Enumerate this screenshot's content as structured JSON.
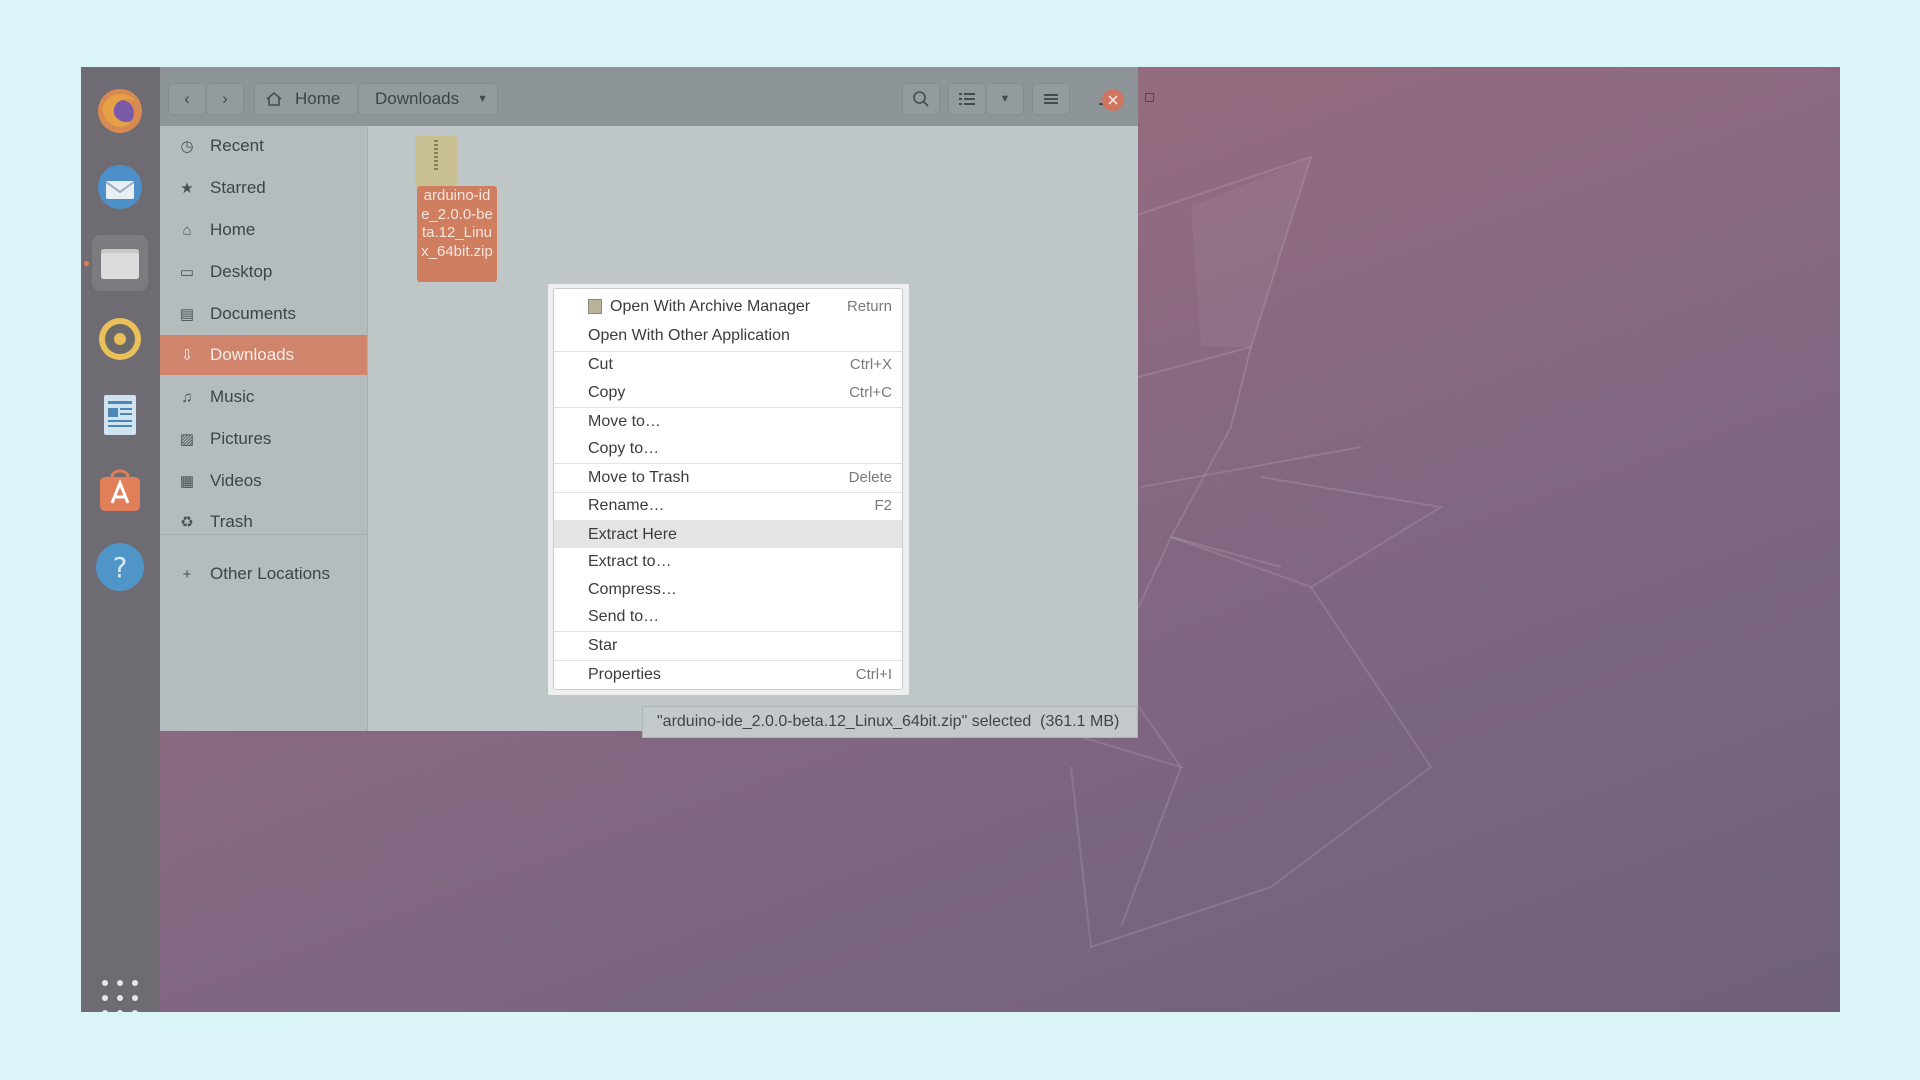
{
  "window": {
    "nav_back": "‹",
    "nav_forward": "›",
    "breadcrumb": [
      "Home",
      "Downloads"
    ]
  },
  "sidebar": {
    "items": [
      {
        "label": "Recent",
        "icon": "clock-icon"
      },
      {
        "label": "Starred",
        "icon": "star-icon"
      },
      {
        "label": "Home",
        "icon": "home-icon"
      },
      {
        "label": "Desktop",
        "icon": "desktop-icon"
      },
      {
        "label": "Documents",
        "icon": "document-icon"
      },
      {
        "label": "Downloads",
        "icon": "download-icon",
        "selected": true
      },
      {
        "label": "Music",
        "icon": "music-icon"
      },
      {
        "label": "Pictures",
        "icon": "picture-icon"
      },
      {
        "label": "Videos",
        "icon": "video-icon"
      },
      {
        "label": "Trash",
        "icon": "trash-icon"
      }
    ],
    "other_locations": "Other Locations"
  },
  "file": {
    "label": "arduino-ide_2.0.0-beta.12_Linux_64bit.zip"
  },
  "status": {
    "text": "\"arduino-ide_2.0.0-beta.12_Linux_64bit.zip\" selected  (361.1 MB)"
  },
  "context_menu": {
    "items": [
      {
        "label": "Open With Archive Manager",
        "accel": "Return"
      },
      {
        "label": "Open With Other Application",
        "accel": ""
      },
      {
        "label": "Cut",
        "accel": "Ctrl+X"
      },
      {
        "label": "Copy",
        "accel": "Ctrl+C"
      },
      {
        "label": "Move to…",
        "accel": ""
      },
      {
        "label": "Copy to…",
        "accel": ""
      },
      {
        "label": "Move to Trash",
        "accel": "Delete"
      },
      {
        "label": "Rename…",
        "accel": "F2"
      },
      {
        "label": "Extract Here",
        "accel": "",
        "highlighted": true
      },
      {
        "label": "Extract to…",
        "accel": ""
      },
      {
        "label": "Compress…",
        "accel": ""
      },
      {
        "label": "Send to…",
        "accel": ""
      },
      {
        "label": "Star",
        "accel": ""
      },
      {
        "label": "Properties",
        "accel": "Ctrl+I"
      }
    ]
  },
  "colors": {
    "accent": "#e95420",
    "selection": "#d0846b"
  }
}
